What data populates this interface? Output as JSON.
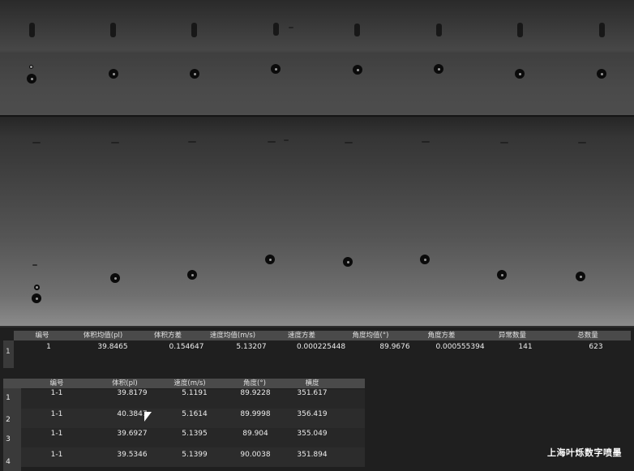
{
  "summary": {
    "headers": [
      "编号",
      "体积均值(pl)",
      "体积方差",
      "速度均值(m/s)",
      "速度方差",
      "角度均值(°)",
      "角度方差",
      "异常数量",
      "总数量"
    ],
    "row_label": "1",
    "row": [
      "1",
      "39.8465",
      "0.154647",
      "5.13207",
      "0.000225448",
      "89.9676",
      "0.000555394",
      "141",
      "623"
    ]
  },
  "detail": {
    "headers": [
      "编号",
      "体积(pl)",
      "速度(m/s)",
      "角度(°)",
      "横度"
    ],
    "rows": [
      {
        "label": "1",
        "cells": [
          "1-1",
          "39.8179",
          "5.1191",
          "89.9228",
          "351.617"
        ]
      },
      {
        "label": "2",
        "cells": [
          "1-1",
          "40.3847",
          "5.1614",
          "89.9998",
          "356.419"
        ]
      },
      {
        "label": "3",
        "cells": [
          "1-1",
          "39.6927",
          "5.1395",
          "89.904",
          "355.049"
        ]
      },
      {
        "label": "4",
        "cells": [
          "1-1",
          "39.5346",
          "5.1399",
          "90.0038",
          "351.894"
        ]
      }
    ]
  },
  "watermark": "上海叶烁数字喷墨"
}
